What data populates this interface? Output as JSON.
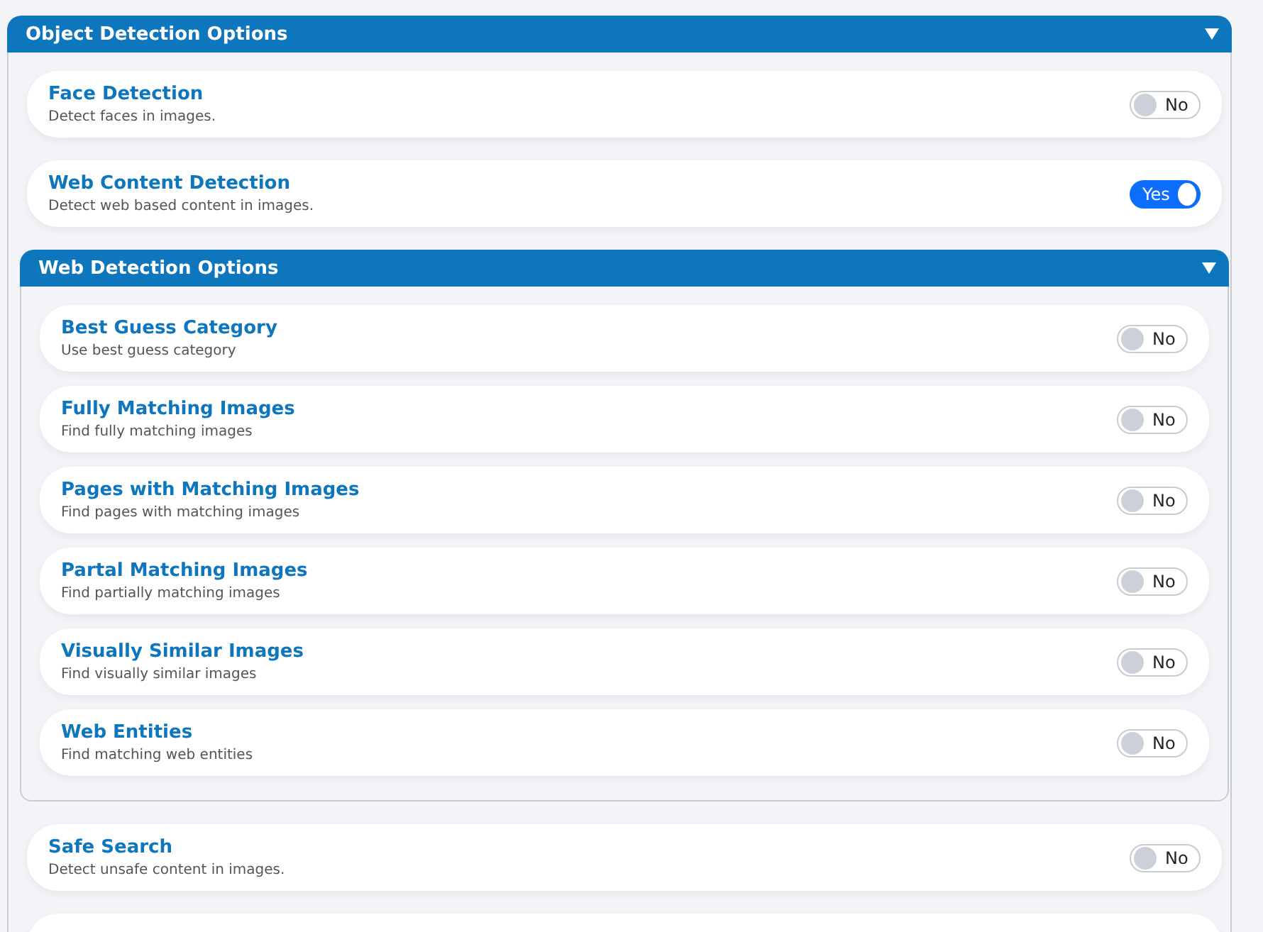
{
  "panel": {
    "title": "Object Detection Options",
    "expanded": true,
    "items": [
      {
        "kind": "toggle",
        "title": "Face Detection",
        "description": "Detect faces in images.",
        "on": false,
        "state_label": "No"
      },
      {
        "kind": "toggle",
        "title": "Web Content Detection",
        "description": "Detect web based content in images.",
        "on": true,
        "state_label": "Yes"
      },
      {
        "kind": "panel",
        "title": "Web Detection Options",
        "expanded": true,
        "items": [
          {
            "kind": "toggle",
            "title": "Best Guess Category",
            "description": "Use best guess category",
            "on": false,
            "state_label": "No"
          },
          {
            "kind": "toggle",
            "title": "Fully Matching Images",
            "description": "Find fully matching images",
            "on": false,
            "state_label": "No"
          },
          {
            "kind": "toggle",
            "title": "Pages with Matching Images",
            "description": "Find pages with matching images",
            "on": false,
            "state_label": "No"
          },
          {
            "kind": "toggle",
            "title": "Partal Matching Images",
            "description": "Find partially matching images",
            "on": false,
            "state_label": "No"
          },
          {
            "kind": "toggle",
            "title": "Visually Similar Images",
            "description": "Find visually similar images",
            "on": false,
            "state_label": "No"
          },
          {
            "kind": "toggle",
            "title": "Web Entities",
            "description": "Find matching web entities",
            "on": false,
            "state_label": "No"
          }
        ]
      },
      {
        "kind": "toggle",
        "title": "Safe Search",
        "description": "Detect unsafe content in images.",
        "on": false,
        "state_label": "No"
      },
      {
        "kind": "card"
      }
    ]
  }
}
